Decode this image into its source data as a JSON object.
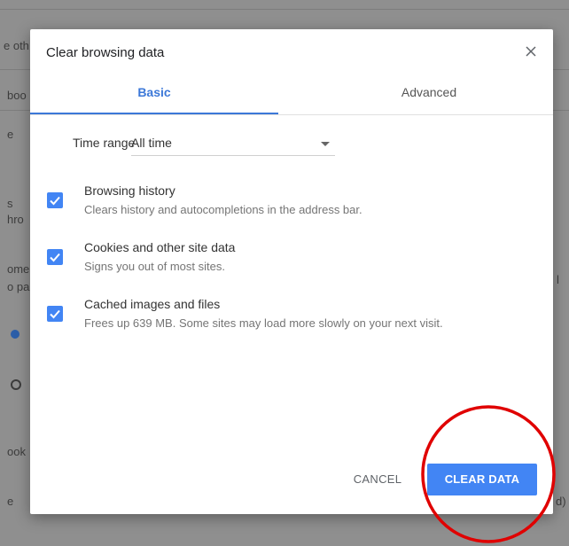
{
  "background": {
    "fragments": [
      "e oth",
      "boo",
      "e",
      "s",
      "hro",
      "ome",
      "o pa",
      "ook",
      "e",
      "d)",
      "l"
    ]
  },
  "dialog": {
    "title": "Clear browsing data",
    "close_icon": "close-icon",
    "tabs": [
      {
        "label": "Basic",
        "selected": true
      },
      {
        "label": "Advanced",
        "selected": false
      }
    ],
    "time_range": {
      "label": "Time range",
      "value": "All time"
    },
    "options": [
      {
        "title": "Browsing history",
        "description": "Clears history and autocompletions in the address bar.",
        "checked": true
      },
      {
        "title": "Cookies and other site data",
        "description": "Signs you out of most sites.",
        "checked": true
      },
      {
        "title": "Cached images and files",
        "description": "Frees up 639 MB. Some sites may load more slowly on your next visit.",
        "checked": true
      }
    ],
    "cancel_label": "CANCEL",
    "clear_label": "CLEAR DATA"
  },
  "colors": {
    "accent": "#4285f4",
    "tab_accent": "#3c78d8",
    "annotation": "#e00000"
  }
}
